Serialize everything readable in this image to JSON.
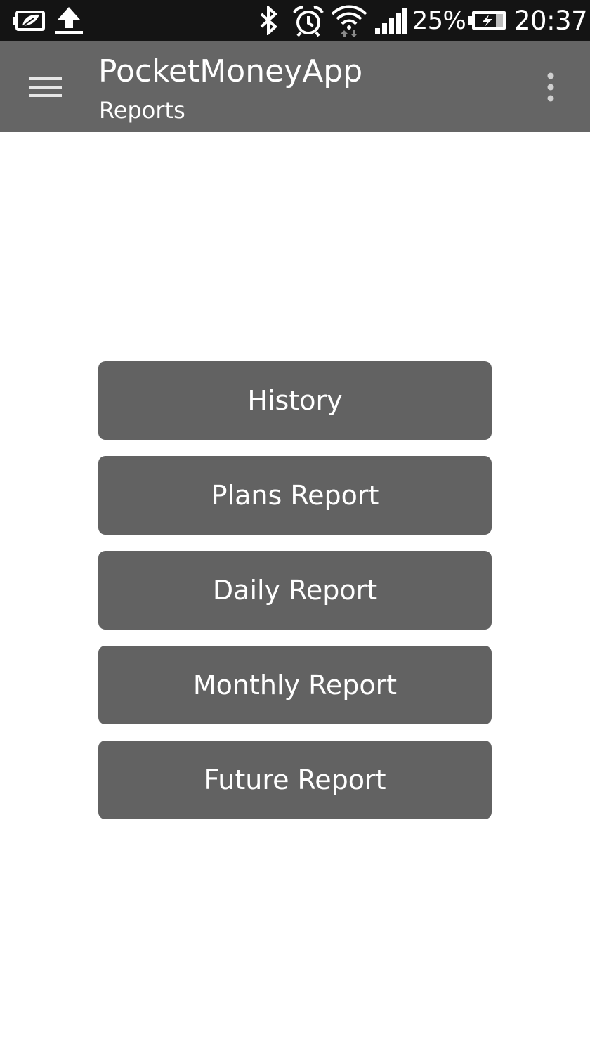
{
  "status_bar": {
    "left_icons": [
      "battery-saver-icon",
      "upload-icon"
    ],
    "right_icons": [
      "bluetooth-icon",
      "alarm-icon",
      "wifi-icon",
      "signal-icon",
      "battery-charging-icon"
    ],
    "battery_percent": "25%",
    "time": "20:37"
  },
  "action_bar": {
    "title": "PocketMoneyApp",
    "subtitle": "Reports",
    "menu_icon": "hamburger-menu-icon",
    "overflow_icon": "overflow-menu-icon",
    "background": "#656565"
  },
  "reports": {
    "buttons": [
      {
        "label": "History"
      },
      {
        "label": "Plans Report"
      },
      {
        "label": "Daily Report"
      },
      {
        "label": "Monthly Report"
      },
      {
        "label": "Future Report"
      }
    ],
    "button_color": "#626262"
  }
}
